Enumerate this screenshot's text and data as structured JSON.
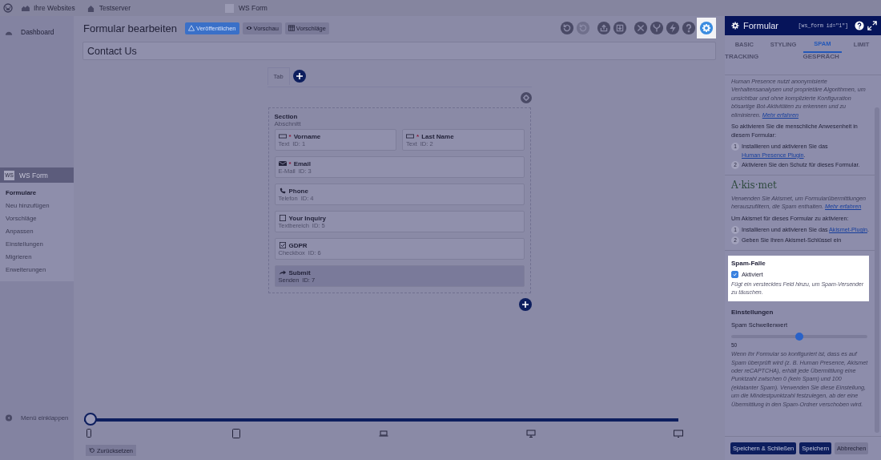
{
  "admin_bar": {
    "items": [
      {
        "label": "Ihre Websites",
        "kind": "sites"
      },
      {
        "label": "Testserver",
        "kind": "home"
      },
      {
        "label": "WS Form",
        "kind": "logo"
      }
    ]
  },
  "sidebar": {
    "top_item": "Dashboard",
    "plugin": {
      "logo": "WS",
      "label": "WS Form",
      "items": [
        {
          "label": "Formulare",
          "selected": true
        },
        {
          "label": "Neu hinzufügen",
          "selected": false
        },
        {
          "label": "Vorschläge",
          "selected": false
        },
        {
          "label": "Anpassen",
          "selected": false
        },
        {
          "label": "Einstellungen",
          "selected": false
        },
        {
          "label": "Migrieren",
          "selected": false
        },
        {
          "label": "Erweiterungen",
          "selected": false
        }
      ]
    },
    "collapse": "Menü einklappen"
  },
  "editor": {
    "title": "Formular bearbeiten",
    "buttons": [
      {
        "label": "Veröffentlichen",
        "kind": "publish"
      },
      {
        "label": "Vorschau",
        "kind": "preview"
      },
      {
        "label": "Vorschläge",
        "kind": "templates"
      }
    ],
    "toolbar": [
      {
        "kind": "undo",
        "disabled": false,
        "selected": false
      },
      {
        "kind": "redo",
        "disabled": true,
        "selected": false
      },
      {
        "kind": "upload",
        "disabled": false,
        "selected": false
      },
      {
        "kind": "download",
        "disabled": false,
        "selected": false
      },
      {
        "kind": "tools",
        "disabled": false,
        "selected": false
      },
      {
        "kind": "fork",
        "disabled": false,
        "selected": false
      },
      {
        "kind": "bolt",
        "disabled": false,
        "selected": false
      },
      {
        "kind": "help",
        "disabled": false,
        "selected": false
      },
      {
        "kind": "settings",
        "disabled": false,
        "selected": true
      }
    ],
    "form_name": "Contact Us",
    "tab": "Tab",
    "section": {
      "title": "Section",
      "subtitle": "Abschnitt",
      "required_mark": "*",
      "fields": [
        {
          "label": "Vorname",
          "type": "Text",
          "id": "ID: 1",
          "required": true,
          "kind": "text",
          "half": true
        },
        {
          "label": "Last Name",
          "type": "Text",
          "id": "ID: 2",
          "required": true,
          "kind": "text",
          "half": true
        },
        {
          "label": "Email",
          "type": "E-Mail",
          "id": "ID: 3",
          "required": true,
          "kind": "email",
          "half": false
        },
        {
          "label": "Phone",
          "type": "Telefon",
          "id": "ID: 4",
          "required": false,
          "kind": "tel",
          "half": false
        },
        {
          "label": "Your Inquiry",
          "type": "Textbereich",
          "id": "ID: 5",
          "required": false,
          "kind": "textarea",
          "half": false
        },
        {
          "label": "GDPR",
          "type": "Checkbox",
          "id": "ID: 6",
          "required": false,
          "kind": "checkbox",
          "half": false
        },
        {
          "label": "Submit",
          "type": "Senden",
          "id": "ID: 7",
          "required": false,
          "kind": "submit",
          "half": false
        }
      ]
    },
    "breakpoints": {
      "level": 0,
      "devices": [
        {
          "kind": "phone"
        },
        {
          "kind": "tablet"
        },
        {
          "kind": "laptop"
        },
        {
          "kind": "desktop"
        },
        {
          "kind": "monitor"
        }
      ]
    },
    "reset_button": "Zurücksetzen"
  },
  "panel": {
    "title": "Formular",
    "shortcode": "[ws_form id=\"1\"]",
    "tabs": [
      {
        "label": "BASIC",
        "selected": false
      },
      {
        "label": "STYLING",
        "selected": false
      },
      {
        "label": "SPAM",
        "selected": true
      },
      {
        "label": "LIMIT",
        "selected": false
      },
      {
        "label": "TRACKING",
        "selected": false
      },
      {
        "label": "GESPRÄCH",
        "selected": false
      }
    ],
    "human_presence": {
      "intro": "Human Presence nutzt anonymisierte Verhaltensanalysen und proprietäre Algorithmen, um unsichtbar und ohne komplizierte Konfiguration bösartige Bot-Aktivitäten zu erkennen und zu eliminieren.",
      "intro_link": "Mehr erfahren",
      "instruction": "So aktivieren Sie die menschliche Anwesenheit in diesem Formular:",
      "steps": [
        {
          "number": "1",
          "text": "Installieren und aktivieren Sie das",
          "link": "Human Presence Plugin",
          "after": "."
        },
        {
          "number": "2",
          "text": "Aktivieren Sie den Schutz für dieses Formular."
        }
      ]
    },
    "akismet": {
      "logo": "A·kis·met",
      "intro": "Verwenden Sie Akismet, um Formularübermittlungen herauszufiltern, die Spam enthalten.",
      "intro_link": "Mehr erfahren",
      "instruction": "Um Akismet für dieses Formular zu aktivieren:",
      "steps": [
        {
          "number": "1",
          "text": "Installieren und aktivieren Sie das",
          "link": "Akismet-Plugin",
          "after": "."
        },
        {
          "number": "2",
          "text": "Geben Sie Ihren Akismet-Schlüssel ein"
        }
      ]
    },
    "spam_trap": {
      "title": "Spam-Falle",
      "highlighted": true,
      "checkbox": {
        "label": "Aktiviert",
        "checked": true
      },
      "help": "Fügt ein verstecktes Feld hinzu, um Spam-Versender zu täuschen."
    },
    "settings": {
      "title": "Einstellungen",
      "threshold": {
        "label": "Spam Schwellenwert",
        "level": 0.5,
        "reading": "50"
      },
      "help": "Wenn Ihr Formular so konfiguriert ist, dass es auf Spam überprüft wird (z. B. Human Presence, Akismet oder reCAPTCHA), erhält jede Übermittlung eine Punktzahl zwischen 0 (kein Spam) und 100 (eklatanter Spam). Verwenden Sie diese Einstellung, um die Mindestpunktzahl festzulegen, ab der eine Übermittlung in den Spam-Ordner verschoben wird."
    },
    "buttons": [
      {
        "label": "Speichern & Schließen",
        "kind": "primary"
      },
      {
        "label": "Speichern",
        "kind": "primary"
      },
      {
        "label": "Abbrechen",
        "kind": "secondary"
      }
    ]
  }
}
